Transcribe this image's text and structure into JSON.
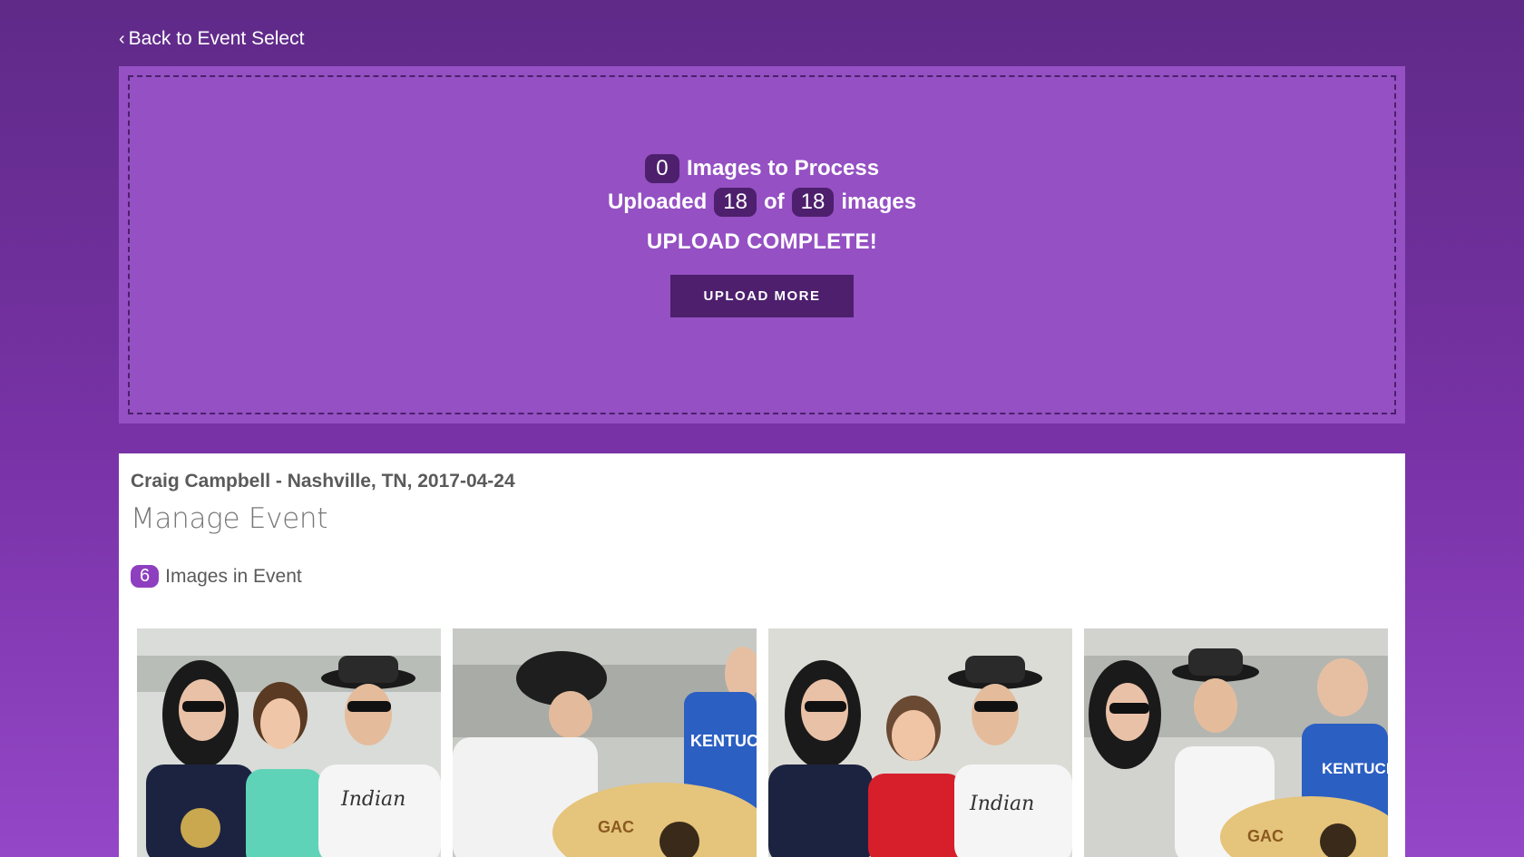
{
  "nav": {
    "back_label": "Back to Event Select"
  },
  "upload": {
    "images_to_process": "0",
    "images_to_process_label": "Images to Process",
    "uploaded_prefix": "Uploaded",
    "uploaded_count": "18",
    "of_label": "of",
    "total_count": "18",
    "images_suffix": "images",
    "status": "UPLOAD COMPLETE!",
    "button_label": "UPLOAD MORE"
  },
  "event": {
    "title": "Craig Campbell - Nashville, TN, 2017-04-24",
    "heading": "Manage Event",
    "image_count": "6",
    "image_count_label": "Images in Event"
  },
  "gallery": [
    {
      "name": "photo-1",
      "accent": "#5fd3b8"
    },
    {
      "name": "photo-2",
      "accent": "#2b5fc2"
    },
    {
      "name": "photo-3",
      "accent": "#d61f2b"
    },
    {
      "name": "photo-4",
      "accent": "#2b5fc2"
    }
  ],
  "colors": {
    "background": "#6a2d95",
    "dropzone": "#9550c3",
    "dark_accent": "#4d1f6d",
    "badge": "#8e3fc0"
  }
}
